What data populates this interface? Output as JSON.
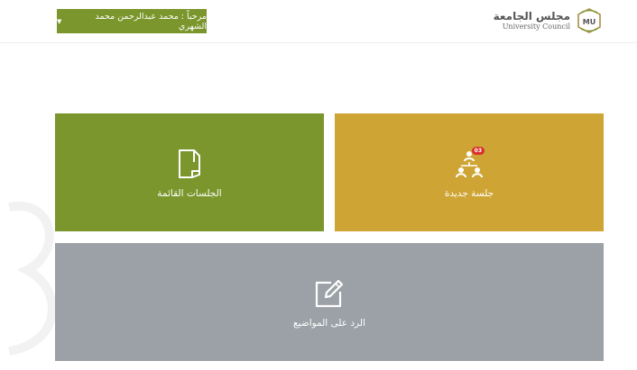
{
  "header": {
    "user_greeting": "مرحباً : محمد عبدالرحمن محمد الشهري",
    "brand_ar": "مجلس الجامعة",
    "brand_en": "University Council",
    "logo_text": "MU"
  },
  "tiles": {
    "new_session": {
      "label": "جلسة جديدة",
      "badge": "03",
      "icon": "people-hierarchy-icon"
    },
    "current_sessions": {
      "label": "الجلسات القائمة",
      "icon": "document-icon"
    },
    "reply_topics": {
      "label": "الرد على المواضيع",
      "icon": "edit-icon"
    }
  },
  "colors": {
    "green": "#7a962c",
    "gold": "#cea434",
    "gray": "#9ba1a6",
    "badge_red": "#d9302c"
  }
}
